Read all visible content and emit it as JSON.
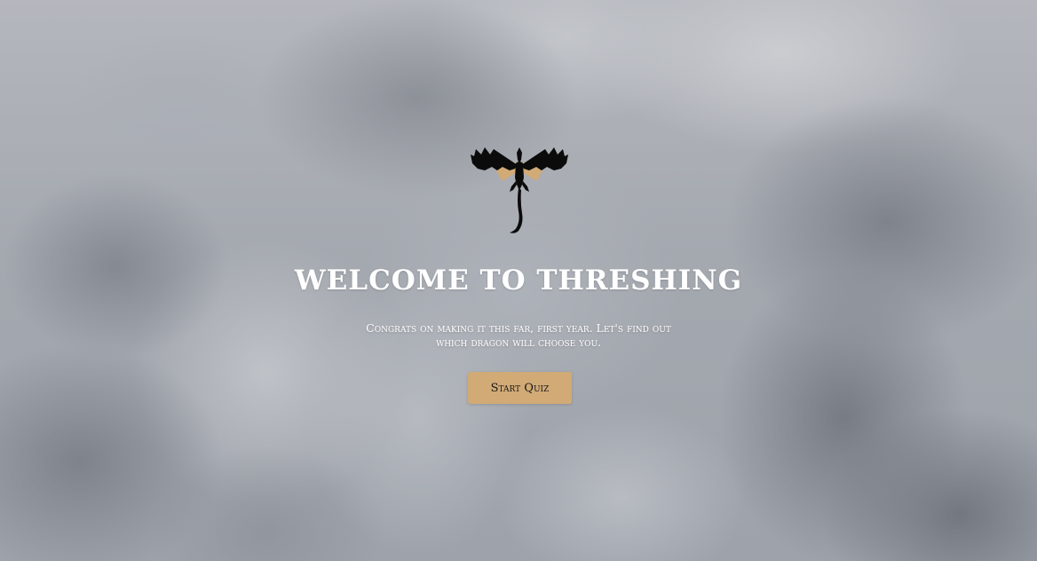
{
  "page": {
    "title": "WELCOME TO THRESHING",
    "subtitle": "Congrats on making it this far, first year. Let's find out which dragon will choose you."
  },
  "logo": {
    "icon": "dragon-icon",
    "wing_color": "#000000",
    "wing_inner_color": "#d1aa76"
  },
  "actions": {
    "start_label": "Start Quiz"
  },
  "colors": {
    "button_bg": "#d1aa76",
    "text": "#ffffff"
  }
}
